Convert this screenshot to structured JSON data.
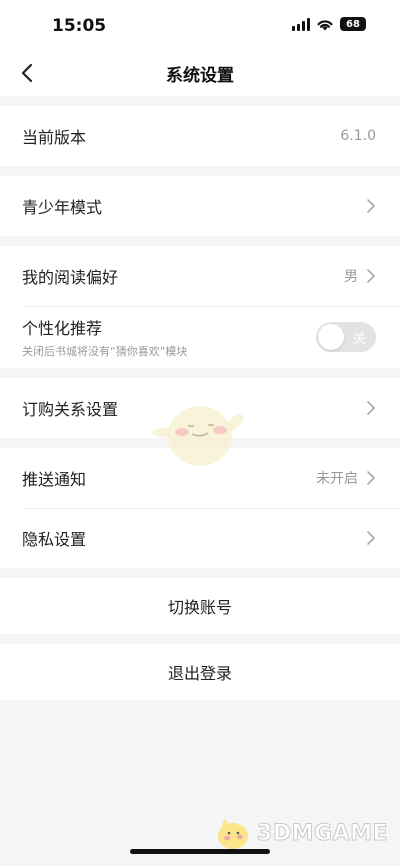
{
  "status_bar": {
    "time": "15:05",
    "battery": "68"
  },
  "header": {
    "title": "系统设置"
  },
  "groups": {
    "version": {
      "label": "当前版本",
      "value": "6.1.0"
    },
    "teen_mode": {
      "label": "青少年模式"
    },
    "reading_pref": {
      "label": "我的阅读偏好",
      "value": "男"
    },
    "personalized": {
      "label": "个性化推荐",
      "subtitle": "关闭后书城将没有“猜你喜欢”模块",
      "toggle_text": "关",
      "enabled": false
    },
    "subscription": {
      "label": "订购关系设置"
    },
    "push": {
      "label": "推送通知",
      "value": "未开启"
    },
    "privacy": {
      "label": "隐私设置"
    }
  },
  "actions": {
    "switch_account": "切换账号",
    "logout": "退出登录"
  },
  "watermark": {
    "text": "3DMGAME"
  },
  "colors": {
    "background": "#f5f5f5",
    "card": "#ffffff",
    "muted_text": "#999999",
    "toggle_off": "#e3e3e3"
  }
}
